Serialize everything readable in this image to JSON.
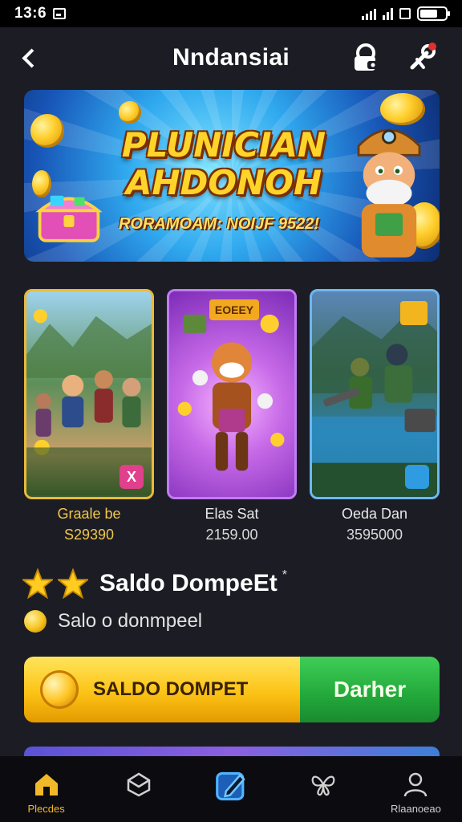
{
  "status_bar": {
    "time": "13:6"
  },
  "header": {
    "title": "Nndansiai"
  },
  "banner": {
    "headline_line1": "PLUNICIAN",
    "headline_line2": "AHDONOH",
    "subline": "RORAMOAM: NOIJF 9522!"
  },
  "games": [
    {
      "name": "Graale be",
      "price": "S29390",
      "badge": "X"
    },
    {
      "name": "Elas Sat",
      "price": "2159.00",
      "tag": "EOEEY"
    },
    {
      "name": "Oeda Dan",
      "price": "3595000"
    }
  ],
  "wallet": {
    "title": "Saldo DompeEt",
    "subtitle": "Salo o donmpeel",
    "button_label": "SALDO DOMPET",
    "cta_label": "Darher"
  },
  "nav": {
    "items": [
      {
        "label": "Plecdes",
        "active": true
      },
      {
        "label": ""
      },
      {
        "label": ""
      },
      {
        "label": ""
      },
      {
        "label": "Rlaanoeao"
      }
    ]
  },
  "colors": {
    "accent_gold": "#f1c64b",
    "cta_green": "#22a83a",
    "background": "#1c1d24"
  }
}
